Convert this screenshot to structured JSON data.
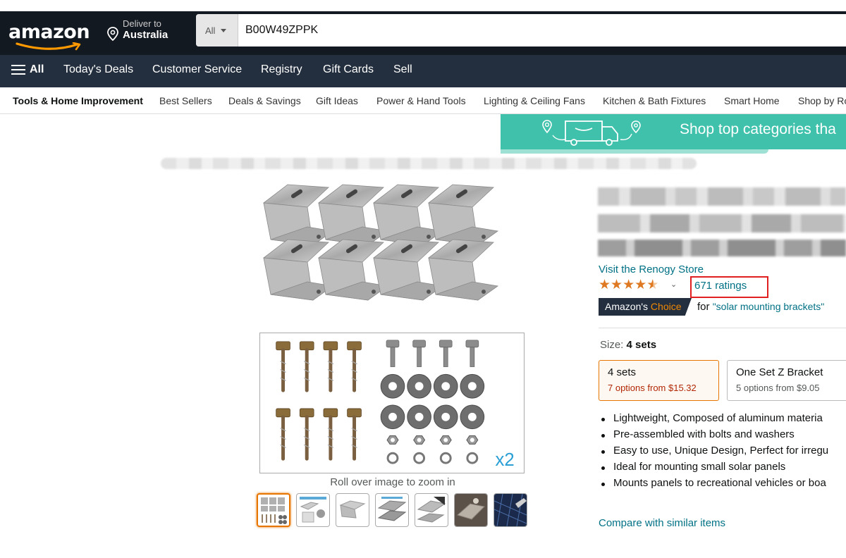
{
  "header": {
    "logo_text": "amazon",
    "deliver_line1": "Deliver to",
    "deliver_line2": "Australia",
    "search_category": "All",
    "search_value": "B00W49ZPPK"
  },
  "nav": {
    "all_label": "All",
    "items": [
      "Today's Deals",
      "Customer Service",
      "Registry",
      "Gift Cards",
      "Sell"
    ]
  },
  "subnav": {
    "items": [
      "Tools & Home Improvement",
      "Best Sellers",
      "Deals & Savings",
      "Gift Ideas",
      "Power & Hand Tools",
      "Lighting & Ceiling Fans",
      "Kitchen & Bath Fixtures",
      "Smart Home",
      "Shop by Ro"
    ]
  },
  "banner": {
    "text": "Shop top categories tha"
  },
  "gallery": {
    "zoom_hint": "Roll over image to zoom in",
    "multiplier_label": "x2",
    "thumbnail_count": 7,
    "selected_thumbnail": 1
  },
  "product": {
    "store_link": "Visit the Renogy Store",
    "star_rating": 4.5,
    "ratings_label": "671 ratings",
    "choice_prefix": "Amazon's",
    "choice_word": "Choice",
    "choice_for": "for",
    "choice_query": "\"solar mounting brackets\"",
    "size_label": "Size:",
    "size_value": "4 sets",
    "options": [
      {
        "name": "4 sets",
        "price_text": "7 options from $15.32",
        "selected": true
      },
      {
        "name": "One Set Z Bracket",
        "price_text": "5 options from $9.05",
        "selected": false
      }
    ],
    "bullets": [
      "Lightweight, Composed of aluminum materia",
      "Pre-assembled with bolts and washers",
      "Easy to use, Unique Design, Perfect for irregu",
      "Ideal for mounting small solar panels",
      "Mounts panels to recreational vehicles or boa"
    ],
    "compare_link": "Compare with similar items"
  },
  "colors": {
    "header_bg": "#131921",
    "nav_bg": "#232f3e",
    "link": "#007185",
    "star": "#de7921",
    "highlight_box": "#e02020",
    "banner_bg": "#3fc1ac"
  }
}
